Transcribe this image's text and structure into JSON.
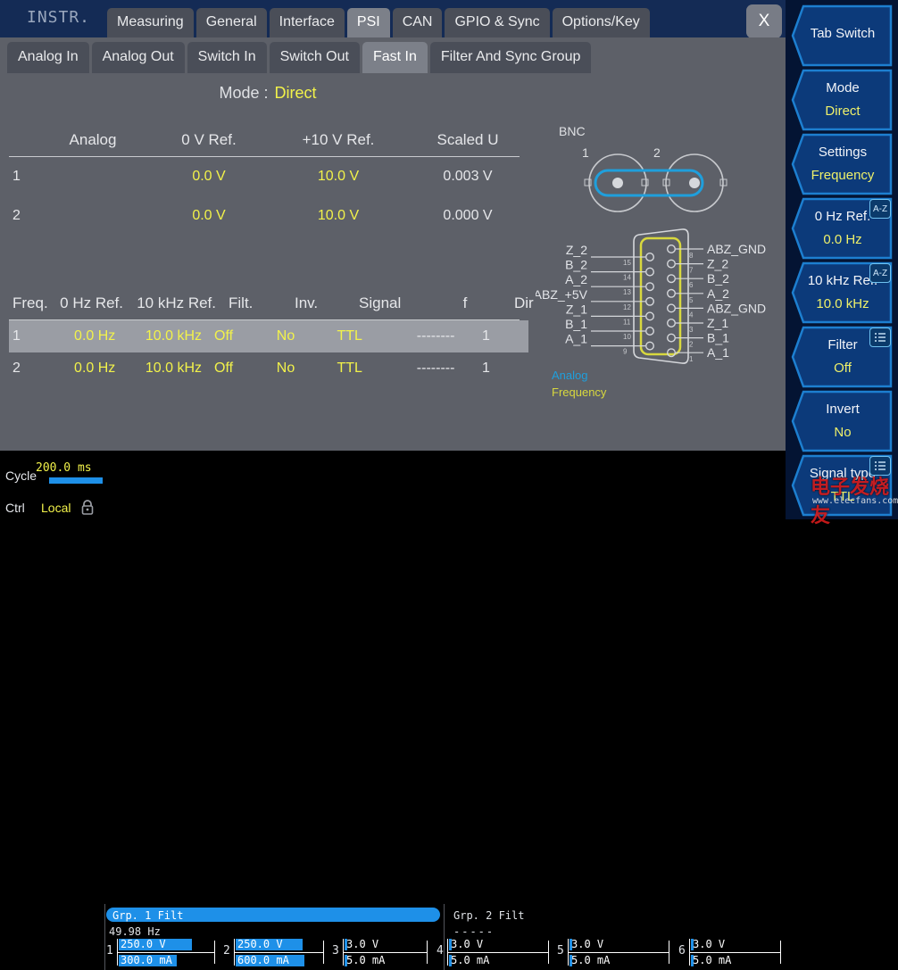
{
  "header": {
    "instrument_label": "INSTR.",
    "close_label": "X",
    "tabs": [
      {
        "label": "Measuring",
        "selected": false
      },
      {
        "label": "General",
        "selected": false
      },
      {
        "label": "Interface",
        "selected": false
      },
      {
        "label": "PSI",
        "selected": true
      },
      {
        "label": "CAN",
        "selected": false
      },
      {
        "label": "GPIO & Sync",
        "selected": false
      },
      {
        "label": "Options/Key",
        "selected": false
      }
    ]
  },
  "subtabs": [
    {
      "label": "Analog In",
      "selected": false
    },
    {
      "label": "Analog Out",
      "selected": false
    },
    {
      "label": "Switch In",
      "selected": false
    },
    {
      "label": "Switch Out",
      "selected": false
    },
    {
      "label": "Fast In",
      "selected": true
    },
    {
      "label": "Filter And Sync Group",
      "selected": false
    }
  ],
  "main": {
    "mode_label": "Mode :",
    "mode_value": "Direct",
    "analog_table": {
      "headers": [
        "Analog",
        "0 V Ref.",
        "+10 V Ref.",
        "Scaled U"
      ],
      "rows": [
        {
          "index": "1",
          "zero_ref": "0.0 V",
          "ten_ref": "10.0 V",
          "scaled": "0.003 V"
        },
        {
          "index": "2",
          "zero_ref": "0.0 V",
          "ten_ref": "10.0 V",
          "scaled": "0.000 V"
        }
      ]
    },
    "freq_table": {
      "headers": [
        "Freq.",
        "0 Hz Ref.",
        "10 kHz Ref.",
        "Filt.",
        "Inv.",
        "Signal",
        "f",
        "Dir"
      ],
      "rows": [
        {
          "index": "1",
          "zero_ref": "0.0 Hz",
          "ten_ref": "10.0 kHz",
          "filt": "Off",
          "inv": "No",
          "signal": "TTL",
          "f": "--------",
          "dir": "1",
          "selected": true
        },
        {
          "index": "2",
          "zero_ref": "0.0 Hz",
          "ten_ref": "10.0 kHz",
          "filt": "Off",
          "inv": "No",
          "signal": "TTL",
          "f": "--------",
          "dir": "1",
          "selected": false
        }
      ]
    },
    "diagram": {
      "bnc_title": "BNC",
      "bnc_1": "1",
      "bnc_2": "2",
      "legend_analog": "Analog",
      "legend_frequency": "Frequency",
      "left_pins": [
        {
          "num": "15",
          "name": "Z_2"
        },
        {
          "num": "14",
          "name": "B_2"
        },
        {
          "num": "13",
          "name": "A_2"
        },
        {
          "num": "12",
          "name": "ABZ_+5V"
        },
        {
          "num": "11",
          "name": "Z_1"
        },
        {
          "num": "10",
          "name": "B_1"
        },
        {
          "num": "9",
          "name": "A_1"
        }
      ],
      "right_pins": [
        {
          "num": "8",
          "name": "ABZ_GND"
        },
        {
          "num": "7",
          "name": "Z_2"
        },
        {
          "num": "6",
          "name": "B_2"
        },
        {
          "num": "5",
          "name": "A_2"
        },
        {
          "num": "4",
          "name": "ABZ_GND"
        },
        {
          "num": "3",
          "name": "Z_1"
        },
        {
          "num": "2",
          "name": "B_1"
        },
        {
          "num": "1",
          "name": "A_1"
        }
      ]
    }
  },
  "sidebar": {
    "buttons": [
      {
        "label": "Tab Switch",
        "value": "",
        "badge": ""
      },
      {
        "label": "Mode",
        "value": "Direct",
        "badge": ""
      },
      {
        "label": "Settings",
        "value": "Frequency",
        "badge": ""
      },
      {
        "label": "0 Hz Ref.",
        "value": "0.0 Hz",
        "badge": "A-Z"
      },
      {
        "label": "10 kHz Ref.",
        "value": "10.0 kHz",
        "badge": "A-Z"
      },
      {
        "label": "Filter",
        "value": "Off",
        "badge": "list"
      },
      {
        "label": "Invert",
        "value": "No",
        "badge": ""
      },
      {
        "label": "Signal type",
        "value": "TTL",
        "badge": "list"
      }
    ]
  },
  "status": {
    "cycle_label": "Cycle",
    "cycle_value": "200.0 ms",
    "ctrl_label": "Ctrl",
    "ctrl_value": "Local",
    "lock_icon": "lock-icon",
    "group1_title": "Grp. 1 Filt",
    "group1_freq": "49.98  Hz",
    "group2_title": "Grp. 2 Filt",
    "group2_freq": "-----",
    "channels": [
      {
        "num": "1",
        "voltage": "250.0 V",
        "current": "300.0 mA",
        "v_pct": 78,
        "i_pct": 62
      },
      {
        "num": "2",
        "voltage": "250.0 V",
        "current": "600.0 mA",
        "v_pct": 78,
        "i_pct": 80
      },
      {
        "num": "3",
        "voltage": "3.0 V",
        "current": "5.0 mA",
        "v_pct": 3,
        "i_pct": 3
      },
      {
        "num": "4",
        "voltage": "3.0 V",
        "current": "5.0 mA",
        "v_pct": 3,
        "i_pct": 3
      },
      {
        "num": "5",
        "voltage": "3.0 V",
        "current": "5.0 mA",
        "v_pct": 3,
        "i_pct": 3
      },
      {
        "num": "6",
        "voltage": "3.0 V",
        "current": "5.0 mA",
        "v_pct": 3,
        "i_pct": 3
      }
    ]
  },
  "watermark": {
    "cn": "电子发烧友",
    "url": "www.elecfans.com"
  },
  "colors": {
    "accent_yellow": "#f2f24a",
    "panel_gray": "#5d6068",
    "header_blue": "#142b55",
    "bar_blue": "#1e90e8",
    "cyan": "#1f9fdc",
    "conn_yellow": "#d8d83e"
  }
}
